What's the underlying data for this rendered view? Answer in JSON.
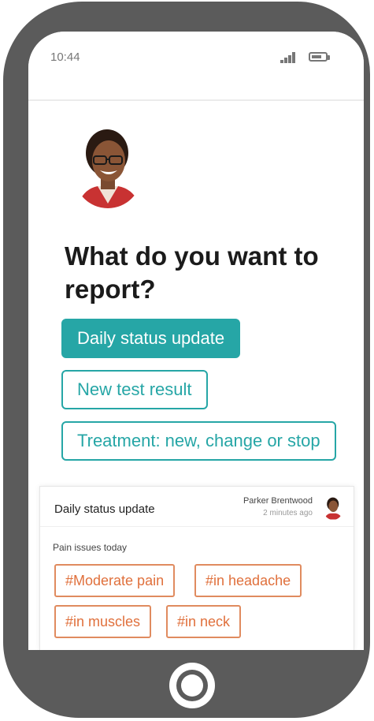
{
  "statusbar": {
    "time": "10:44"
  },
  "screen": {
    "title": "What do you want to report?",
    "options": [
      {
        "label": "Daily status update",
        "selected": true
      },
      {
        "label": "New test result",
        "selected": false
      },
      {
        "label": "Treatment: new, change or stop",
        "selected": false
      }
    ]
  },
  "card": {
    "title": "Daily status update",
    "author": "Parker Brentwood",
    "time_ago": "2 minutes ago",
    "section_label": "Pain issues today",
    "tags": [
      "#Moderate pain",
      "#in headache",
      "#in muscles",
      "#in neck"
    ]
  },
  "colors": {
    "accent": "#26a6a6",
    "tag": "#e0703c",
    "phone_body": "#5b5b5b"
  },
  "icons": [
    "signal-icon",
    "battery-icon",
    "home-button-icon"
  ]
}
